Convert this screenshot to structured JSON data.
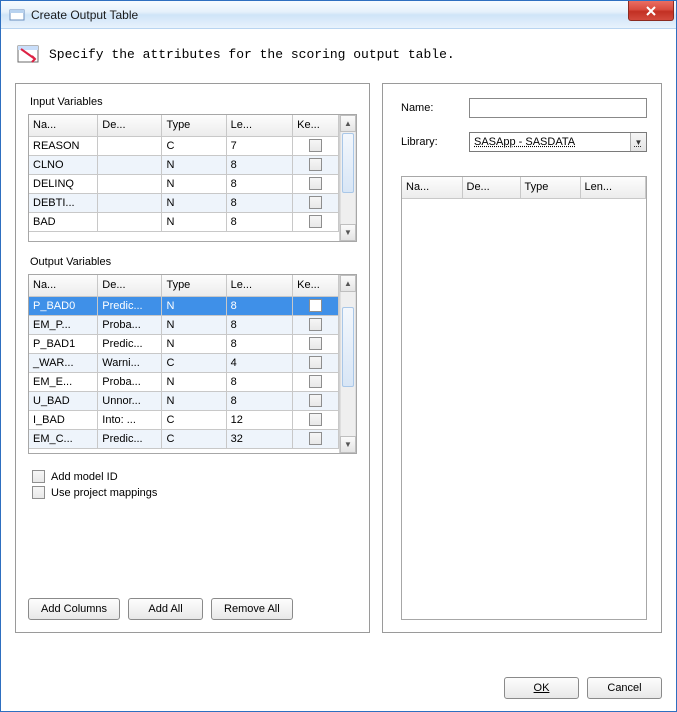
{
  "window": {
    "title": "Create Output Table"
  },
  "instruction": "Specify the attributes for the scoring output table.",
  "left_panel": {
    "input_section_label": "Input Variables",
    "output_section_label": "Output Variables",
    "columns": {
      "name": "Na...",
      "desc": "De...",
      "type": "Type",
      "len": "Le...",
      "keep": "Ke..."
    },
    "input_rows": [
      {
        "name": "REASON",
        "desc": "",
        "type": "C",
        "len": "7"
      },
      {
        "name": "CLNO",
        "desc": "",
        "type": "N",
        "len": "8"
      },
      {
        "name": "DELINQ",
        "desc": "",
        "type": "N",
        "len": "8"
      },
      {
        "name": "DEBTI...",
        "desc": "",
        "type": "N",
        "len": "8"
      },
      {
        "name": "BAD",
        "desc": "",
        "type": "N",
        "len": "8"
      }
    ],
    "output_rows": [
      {
        "name": "P_BAD0",
        "desc": "Predic...",
        "type": "N",
        "len": "8",
        "selected": true
      },
      {
        "name": "EM_P...",
        "desc": "Proba...",
        "type": "N",
        "len": "8"
      },
      {
        "name": "P_BAD1",
        "desc": "Predic...",
        "type": "N",
        "len": "8"
      },
      {
        "name": "_WAR...",
        "desc": "Warni...",
        "type": "C",
        "len": "4"
      },
      {
        "name": "EM_E...",
        "desc": "Proba...",
        "type": "N",
        "len": "8"
      },
      {
        "name": "U_BAD",
        "desc": "Unnor...",
        "type": "N",
        "len": "8"
      },
      {
        "name": "I_BAD",
        "desc": "Into: ...",
        "type": "C",
        "len": "12"
      },
      {
        "name": "EM_C...",
        "desc": "Predic...",
        "type": "C",
        "len": "32"
      }
    ],
    "check_add_model_id": "Add model ID",
    "check_use_mappings": "Use project mappings",
    "btn_add_columns": "Add Columns",
    "btn_add_all": "Add All",
    "btn_remove_all": "Remove All"
  },
  "right_panel": {
    "name_label": "Name:",
    "name_value": "",
    "library_label": "Library:",
    "library_value": "SASApp - SASDATA",
    "columns": {
      "name": "Na...",
      "desc": "De...",
      "type": "Type",
      "len": "Len..."
    }
  },
  "footer": {
    "ok": "OK",
    "cancel": "Cancel"
  }
}
